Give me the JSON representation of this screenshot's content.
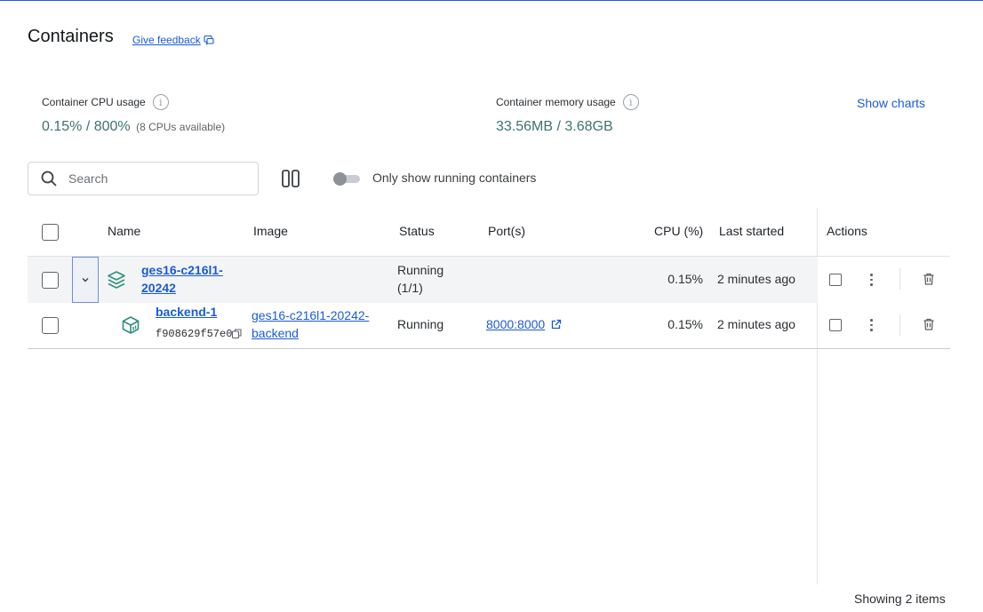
{
  "header": {
    "title": "Containers",
    "feedback_label": "Give feedback"
  },
  "stats": {
    "cpu": {
      "label": "Container CPU usage",
      "used": "0.15%",
      "separator": " / ",
      "total": "800%",
      "note": "(8 CPUs available)"
    },
    "memory": {
      "label": "Container memory usage",
      "used": "33.56MB",
      "separator": " / ",
      "total": "3.68GB"
    },
    "show_charts_label": "Show charts"
  },
  "toolbar": {
    "search_placeholder": "Search",
    "search_value": "",
    "toggle_label": "Only show running containers",
    "toggle_on": false
  },
  "table": {
    "columns": [
      "Name",
      "Image",
      "Status",
      "Port(s)",
      "CPU (%)",
      "Last started",
      "Actions"
    ],
    "group": {
      "name_line1": "ges16-c216l1-",
      "name_line2": "20242",
      "status_line1": "Running",
      "status_line2": "(1/1)",
      "cpu": "0.15%",
      "last_started": "2 minutes ago",
      "expanded": true
    },
    "rows": [
      {
        "name": "backend-1",
        "id": "f908629f57e0",
        "image_line1": "ges16-c216l1-20242-",
        "image_line2": "backend",
        "status": "Running",
        "ports": "8000:8000",
        "cpu": "0.15%",
        "last_started": "2 minutes ago"
      }
    ]
  },
  "footer": {
    "count_label": "Showing 2 items"
  },
  "colors": {
    "accent": "#1a5bd6",
    "stat_value": "#3d7370",
    "icon_green": "#2f8f7e"
  }
}
